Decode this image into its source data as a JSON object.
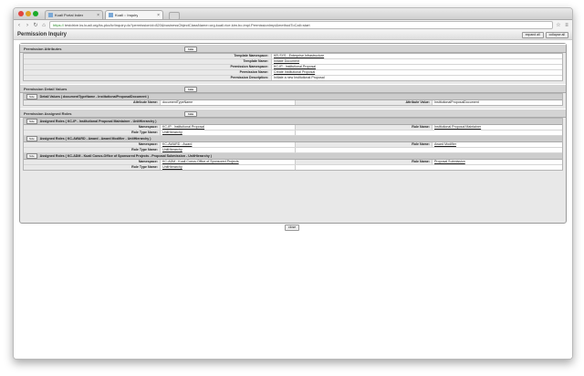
{
  "browser": {
    "tabs": [
      {
        "label": "Kuali Portal Index"
      },
      {
        "label": "Kuali :: Inquiry"
      }
    ],
    "url_https": "https://",
    "url_rest": "testdrive.ks.kuali.org/ks-pko/kr/inquiry.do?permissionId=820&businessObjectClassName=org.kuali.rice.kim.bo.impl.PermissionImpl&methodToCall=start"
  },
  "page": {
    "title": "Permission Inquiry",
    "expand_all": "expand all",
    "collapse_all": "collapse all",
    "hide": "hide",
    "close": "close"
  },
  "permission_attributes": {
    "header": "Permission Attributes",
    "rows": [
      {
        "label": "Template Namespace:",
        "value": "KR-SYS - Enterprise Infrastructure"
      },
      {
        "label": "Template Name:",
        "value": "Initiate Document"
      },
      {
        "label": "Permission Namespace:",
        "value": "KC-IP - Institutional Proposal"
      },
      {
        "label": "Permission Name:",
        "value": "Create Institutional Proposal"
      },
      {
        "label": "Permission Description:",
        "value": "Initiate a new Institutional Proposal"
      }
    ]
  },
  "detail_values": {
    "header": "Permission Detail Values",
    "sub_header": "Detail Values ( documentTypeName - InstitutionalProposalDocument )",
    "attr_name_label": "Attribute Name:",
    "attr_name_value": "documentTypeName",
    "attr_value_label": "Attribute Value:",
    "attr_value_value": "InstitutionalProposalDocument"
  },
  "assigned_roles": {
    "header": "Permission Assigned Roles",
    "roles": [
      {
        "title": "Assigned Roles ( KC-IP - Institutional Proposal Maintainer - UnitHierarchy )",
        "namespace_label": "Namespace:",
        "namespace": "KC-IP - Institutional Proposal",
        "role_name_label": "Role Name:",
        "role_name": "Institutional Proposal Maintainer",
        "role_type_label": "Role Type Name:",
        "role_type": "UnitHierarchy"
      },
      {
        "title": "Assigned Roles ( KC-AWARD - Award - Award Modifier - UnitHierarchy )",
        "namespace_label": "Namespace:",
        "namespace": "KC-AWARD - Award",
        "role_name_label": "Role Name:",
        "role_name": "Award Modifier",
        "role_type_label": "Role Type Name:",
        "role_type": "UnitHierarchy"
      },
      {
        "title": "Assigned Roles ( KC-ADM - Kuali Coeus-Office of Sponsored Projects - Proposal Submission - UnitHierarchy )",
        "namespace_label": "Namespace:",
        "namespace": "KC-ADM - Kuali Coeus-Office of Sponsored Projects",
        "role_name_label": "Role Name:",
        "role_name": "Proposal Submission",
        "role_type_label": "Role Type Name:",
        "role_type": "UnitHierarchy"
      }
    ]
  }
}
